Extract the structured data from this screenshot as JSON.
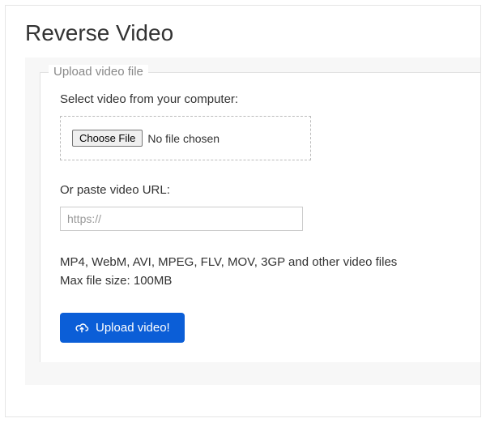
{
  "page": {
    "title": "Reverse Video"
  },
  "upload": {
    "legend": "Upload video file",
    "select_label": "Select video from your computer:",
    "choose_file_label": "Choose File",
    "file_status": "No file chosen",
    "url_label": "Or paste video URL:",
    "url_placeholder": "https://",
    "url_value": "",
    "formats_text": "MP4, WebM, AVI, MPEG, FLV, MOV, 3GP and other video files",
    "maxsize_text": "Max file size: 100MB",
    "upload_button_label": "Upload video!"
  }
}
